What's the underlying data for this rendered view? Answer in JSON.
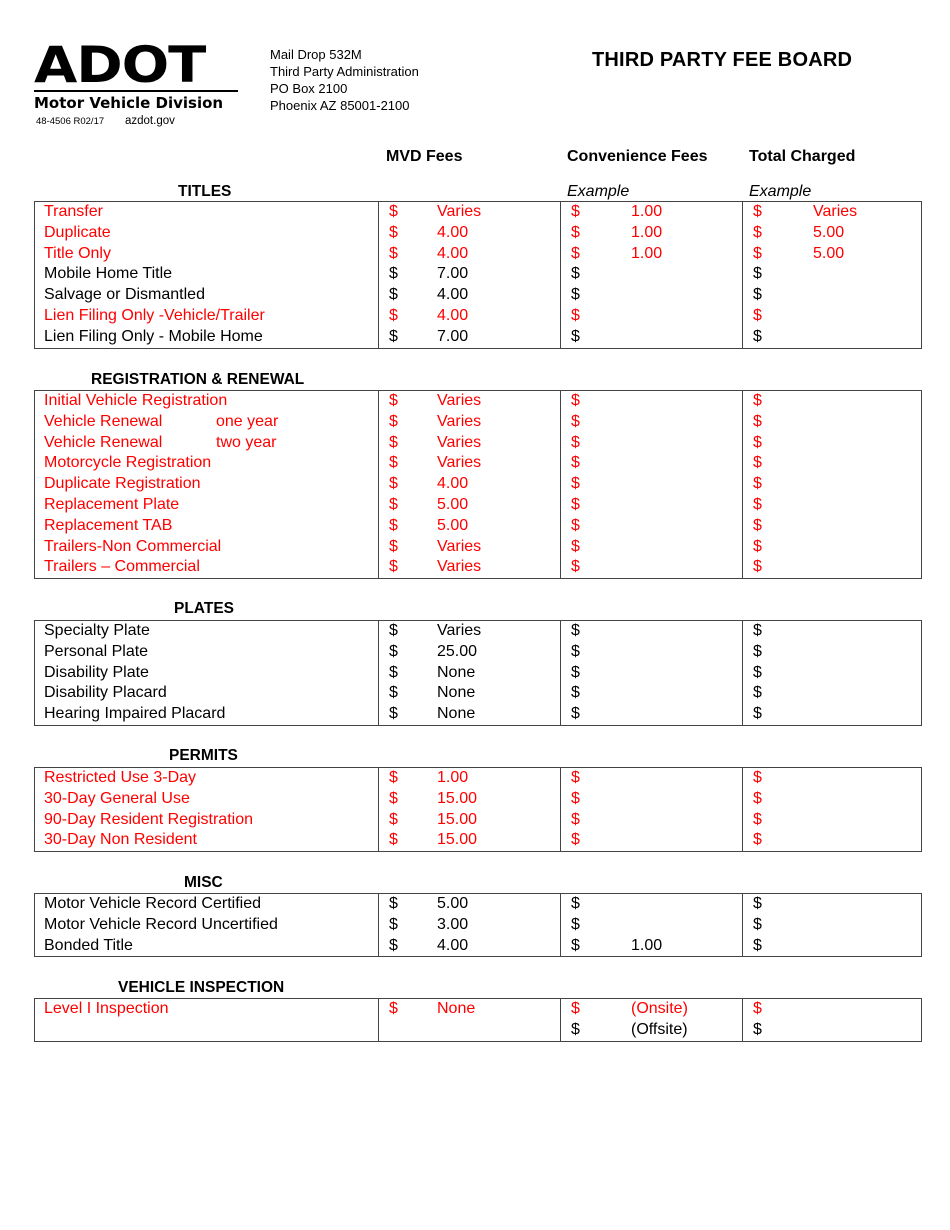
{
  "header": {
    "logo_text": "ADOT",
    "division": "Motor Vehicle Division",
    "form_number": "48-4506 R02/17",
    "website": "azdot.gov",
    "address": [
      "Mail Drop 532M",
      "Third Party Administration",
      "PO Box 2100",
      "Phoenix AZ  85001-2100"
    ],
    "title": "THIRD PARTY FEE BOARD"
  },
  "columns": {
    "mvd": "MVD Fees",
    "convenience": "Convenience Fees",
    "total": "Total Charged",
    "example_conv": "Example",
    "example_total": "Example"
  },
  "colors": {
    "highlight": "#ff0000",
    "normal": "#000000"
  },
  "sections": [
    {
      "title": "TITLES",
      "rows": [
        {
          "desc": "Transfer",
          "sub": "",
          "mvd": "Varies",
          "conv": "1.00",
          "total": "Varies",
          "red": true
        },
        {
          "desc": "Duplicate",
          "sub": "",
          "mvd": "4.00",
          "conv": "1.00",
          "total": "5.00",
          "red": true
        },
        {
          "desc": "Title Only",
          "sub": "",
          "mvd": "4.00",
          "conv": "1.00",
          "total": "5.00",
          "red": true
        },
        {
          "desc": "Mobile Home Title",
          "sub": "",
          "mvd": "7.00",
          "conv": "",
          "total": "",
          "red": false
        },
        {
          "desc": "Salvage or Dismantled",
          "sub": "",
          "mvd": "4.00",
          "conv": "",
          "total": "",
          "red": false
        },
        {
          "desc": "Lien Filing Only -Vehicle/Trailer",
          "sub": "",
          "mvd": "4.00",
          "conv": "",
          "total": "",
          "red": true
        },
        {
          "desc": "Lien Filing Only - Mobile Home",
          "sub": "",
          "mvd": "7.00",
          "conv": "",
          "total": "",
          "red": false
        }
      ]
    },
    {
      "title": "REGISTRATION & RENEWAL",
      "rows": [
        {
          "desc": "Initial Vehicle Registration",
          "sub": "",
          "mvd": "Varies",
          "conv": "",
          "total": "",
          "red": true
        },
        {
          "desc": "Vehicle Renewal",
          "sub": "one year",
          "mvd": "Varies",
          "conv": "",
          "total": "",
          "red": true
        },
        {
          "desc": "Vehicle Renewal",
          "sub": "two year",
          "mvd": "Varies",
          "conv": "",
          "total": "",
          "red": true
        },
        {
          "desc": "Motorcycle Registration",
          "sub": "",
          "mvd": "Varies",
          "conv": "",
          "total": "",
          "red": true
        },
        {
          "desc": "Duplicate Registration",
          "sub": "",
          "mvd": "4.00",
          "conv": "",
          "total": "",
          "red": true
        },
        {
          "desc": "Replacement Plate",
          "sub": "",
          "mvd": "5.00",
          "conv": "",
          "total": "",
          "red": true
        },
        {
          "desc": "Replacement TAB",
          "sub": "",
          "mvd": "5.00",
          "conv": "",
          "total": "",
          "red": true
        },
        {
          "desc": "Trailers-Non Commercial",
          "sub": "",
          "mvd": "Varies",
          "conv": "",
          "total": "",
          "red": true
        },
        {
          "desc": "Trailers – Commercial",
          "sub": "",
          "mvd": "Varies",
          "conv": "",
          "total": "",
          "red": true
        }
      ]
    },
    {
      "title": "PLATES",
      "rows": [
        {
          "desc": "Specialty Plate",
          "sub": "",
          "mvd": "Varies",
          "conv": "",
          "total": "",
          "red": false
        },
        {
          "desc": "Personal Plate",
          "sub": "",
          "mvd": "25.00",
          "conv": "",
          "total": "",
          "red": false
        },
        {
          "desc": "Disability Plate",
          "sub": "",
          "mvd": "None",
          "conv": "",
          "total": "",
          "red": false
        },
        {
          "desc": "Disability Placard",
          "sub": "",
          "mvd": "None",
          "conv": "",
          "total": "",
          "red": false
        },
        {
          "desc": "Hearing Impaired Placard",
          "sub": "",
          "mvd": "None",
          "conv": "",
          "total": "",
          "red": false
        }
      ]
    },
    {
      "title": "PERMITS",
      "rows": [
        {
          "desc": "Restricted Use 3-Day",
          "sub": "",
          "mvd": "1.00",
          "conv": "",
          "total": "",
          "red": true
        },
        {
          "desc": "30-Day General Use",
          "sub": "",
          "mvd": "15.00",
          "conv": "",
          "total": "",
          "red": true
        },
        {
          "desc": "90-Day Resident Registration",
          "sub": "",
          "mvd": "15.00",
          "conv": "",
          "total": "",
          "red": true
        },
        {
          "desc": "30-Day Non Resident",
          "sub": "",
          "mvd": "15.00",
          "conv": "",
          "total": "",
          "red": true
        }
      ]
    },
    {
      "title": "MISC",
      "rows": [
        {
          "desc": "Motor Vehicle Record Certified",
          "sub": "",
          "mvd": "5.00",
          "conv": "",
          "total": "",
          "red": false
        },
        {
          "desc": "Motor Vehicle Record Uncertified",
          "sub": "",
          "mvd": "3.00",
          "conv": "",
          "total": "",
          "red": false
        },
        {
          "desc": "Bonded Title",
          "sub": "",
          "mvd": "4.00",
          "conv": "1.00",
          "total": "",
          "red": false
        }
      ]
    },
    {
      "title": "VEHICLE INSPECTION",
      "rows": [
        {
          "desc": "Level I Inspection",
          "sub": "",
          "mvd": "None",
          "conv": "(Onsite)",
          "total": "",
          "red": true
        },
        {
          "desc": "",
          "sub": "",
          "mvd": "",
          "conv": "(Offsite)",
          "total": "",
          "red": false,
          "no_mvd_dollar": true,
          "conv_only": true
        }
      ]
    }
  ],
  "currency_symbol": "$"
}
